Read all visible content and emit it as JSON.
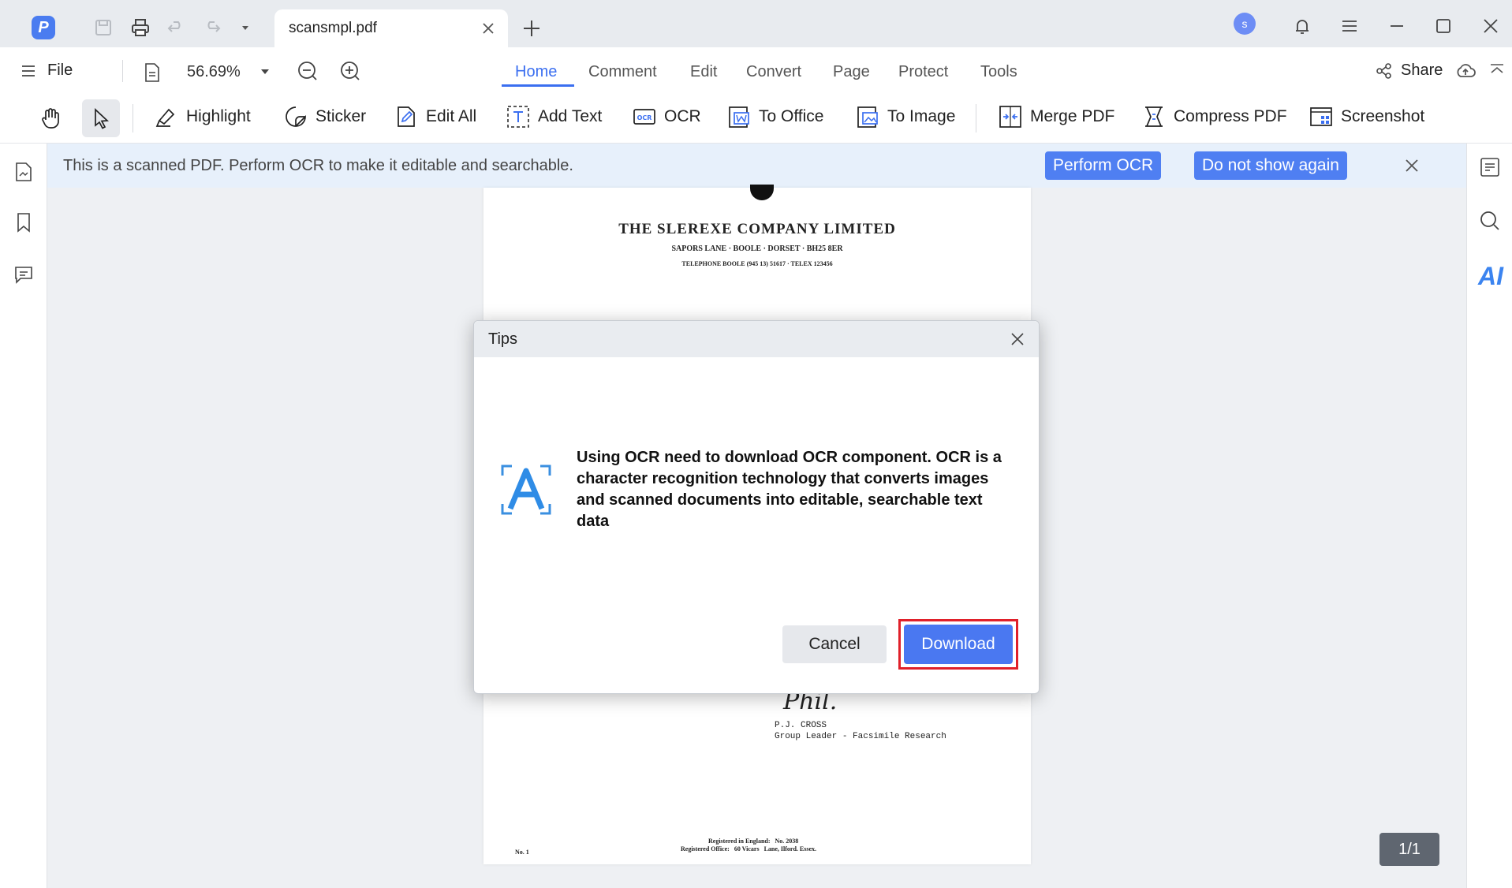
{
  "titlebar": {
    "tab_title": "scansmpl.pdf",
    "avatar_initial": "s"
  },
  "menubar": {
    "file_label": "File",
    "zoom_value": "56.69%",
    "tabs": [
      "Home",
      "Comment",
      "Edit",
      "Convert",
      "Page",
      "Protect",
      "Tools"
    ],
    "active_tab": "Home",
    "share_label": "Share"
  },
  "toolbar": {
    "highlight": "Highlight",
    "sticker": "Sticker",
    "edit_all": "Edit All",
    "add_text": "Add Text",
    "ocr": "OCR",
    "to_office": "To Office",
    "to_image": "To Image",
    "merge_pdf": "Merge PDF",
    "compress_pdf": "Compress PDF",
    "screenshot": "Screenshot"
  },
  "banner": {
    "message": "This is a scanned PDF. Perform OCR to make it editable and searchable.",
    "perform_ocr": "Perform OCR",
    "do_not_show": "Do not show again"
  },
  "document": {
    "company": "THE SLEREXE COMPANY LIMITED",
    "address": "SAPORS LANE · BOOLE · DORSET · BH25 8ER",
    "telephone": "TELEPHONE BOOLE (945 13) 51617 · TELEX 123456",
    "signature": "Phil.",
    "signer_name": "P.J. CROSS",
    "signer_title": "Group Leader - Facsimile Research",
    "footer_left": "No. 1",
    "footer_reg": "Registered in England:   No. 2038",
    "footer_office": "Registered Office:   60 Vicars   Lane, Ilford. Essex."
  },
  "right_sidebar": {
    "ai_label": "AI"
  },
  "page_counter": "1/1",
  "dialog": {
    "title": "Tips",
    "message": "Using OCR need to download OCR component. OCR is a character recognition technology that converts images and scanned documents into editable, searchable text data",
    "cancel_label": "Cancel",
    "download_label": "Download"
  },
  "colors": {
    "accent": "#3b6ff0",
    "button_blue": "#4a78f1",
    "highlight_frame": "#e0202a",
    "banner_bg": "#e7f0fb"
  }
}
